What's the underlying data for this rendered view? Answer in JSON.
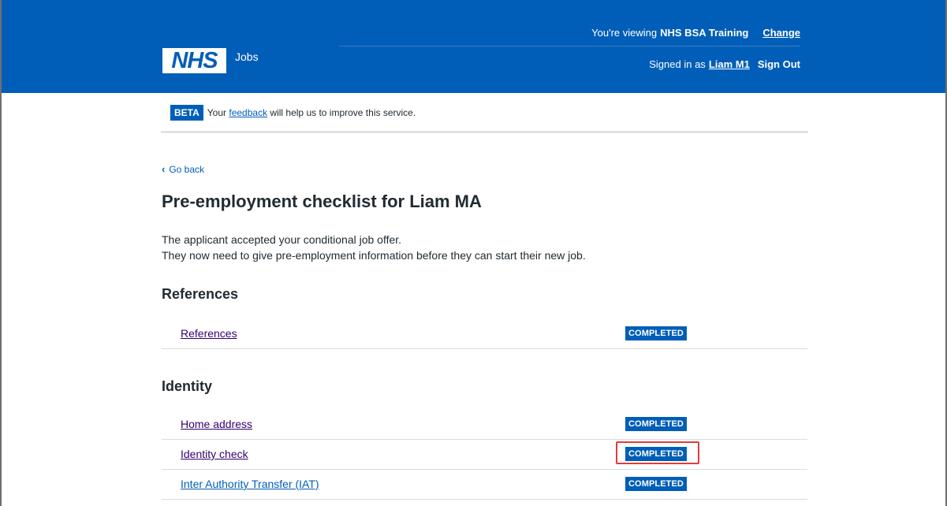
{
  "header": {
    "viewing_prefix": "You're viewing",
    "org_name": "NHS BSA Training",
    "change_link": "Change",
    "logo_text": "NHS",
    "service_name": "Jobs",
    "signed_in_prefix": "Signed in as",
    "user_name": "Liam M1",
    "sign_out": "Sign Out",
    "colors": {
      "brand": "#005eb8",
      "text_on_brand": "#ffffff"
    }
  },
  "beta_banner": {
    "tag": "BETA",
    "text_before": "Your",
    "link": "feedback",
    "text_after": "will help us to improve this service."
  },
  "back_link": {
    "icon": "chevron-left-icon",
    "label": "Go back"
  },
  "page": {
    "title": "Pre-employment checklist for Liam MA",
    "intro_line1": "The applicant accepted your conditional job offer.",
    "intro_line2": "They now need to give pre-employment information before they can start their new job."
  },
  "sections": [
    {
      "heading": "References",
      "tasks": [
        {
          "label": "References",
          "status": "COMPLETED"
        }
      ]
    },
    {
      "heading": "Identity",
      "tasks": [
        {
          "label": "Home address",
          "status": "COMPLETED"
        },
        {
          "label": "Identity check",
          "status": "COMPLETED",
          "highlighted": true
        },
        {
          "label": "Inter Authority Transfer (IAT)",
          "status": "COMPLETED"
        }
      ]
    }
  ],
  "colors": {
    "status_tag": "#005eb8",
    "visited_link": "#330072",
    "link": "#005eb8",
    "highlight": "#e03c3c"
  }
}
